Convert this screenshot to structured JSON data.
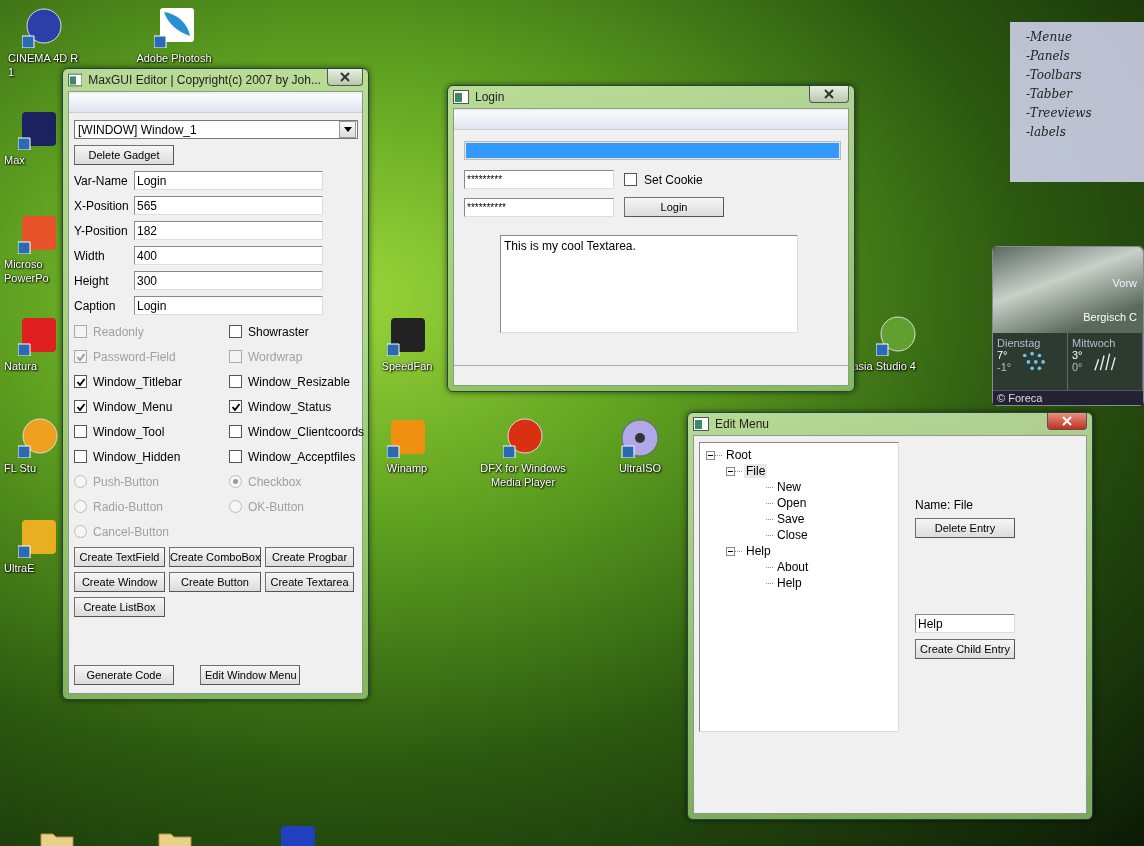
{
  "desktop_icons": [
    {
      "kind": "globe",
      "label": [
        "CINEMA 4D R",
        "1"
      ]
    },
    {
      "kind": "feather",
      "label": [
        "Adobe Photosh"
      ]
    },
    {
      "kind": "blitz",
      "label": [
        "Max"
      ]
    },
    {
      "kind": "slides",
      "label": [
        "Microso",
        "PowerPo"
      ]
    },
    {
      "kind": "paint",
      "label": [
        "Natura"
      ]
    },
    {
      "kind": "fruit",
      "label": [
        "FL Stu"
      ]
    },
    {
      "kind": "editor",
      "label": [
        "UltraE"
      ]
    },
    {
      "kind": "fan",
      "label": [
        "SpeedFan"
      ]
    },
    {
      "kind": "bolt",
      "label": [
        "Winamp"
      ]
    },
    {
      "kind": "dfx",
      "label": [
        "DFX for Windows",
        "Media Player"
      ]
    },
    {
      "kind": "disc",
      "label": [
        "UltraISO"
      ]
    },
    {
      "kind": "camtasia",
      "label": [
        "asia Studio 4"
      ]
    },
    {
      "kind": "folder"
    },
    {
      "kind": "folder"
    },
    {
      "kind": "network"
    }
  ],
  "note": {
    "lines": [
      "-Menue",
      "-Panels",
      "-Toolbars",
      "-Tabber",
      "-Treeviews",
      "-labels"
    ]
  },
  "weather": {
    "condition": "Vorw",
    "city": "Bergisch C",
    "days": [
      {
        "name": "Dienstag",
        "high": "7°",
        "low": "-1°",
        "kind": "rain"
      },
      {
        "name": "Mittwoch",
        "high": "3°",
        "low": "0°",
        "kind": "sleet"
      }
    ],
    "credit": "© Foreca"
  },
  "editor": {
    "title": "MaxGUI Editor | Copyright(c) 2007 by Joh...",
    "combo": "[WINDOW] Window_1",
    "delete_button": "Delete Gadget",
    "fields": [
      {
        "label": "Var-Name",
        "value": "Login"
      },
      {
        "label": "X-Position",
        "value": "565"
      },
      {
        "label": "Y-Position",
        "value": "182"
      },
      {
        "label": "Width",
        "value": "400"
      },
      {
        "label": "Height",
        "value": "300"
      },
      {
        "label": "Caption",
        "value": "Login"
      }
    ],
    "options": [
      {
        "kind": "checkbox",
        "label": "Readonly",
        "checked": false,
        "disabled": true
      },
      {
        "kind": "checkbox",
        "label": "Showraster",
        "checked": false,
        "disabled": false
      },
      {
        "kind": "checkbox",
        "label": "Password-Field",
        "checked": true,
        "disabled": true
      },
      {
        "kind": "checkbox",
        "label": "Wordwrap",
        "checked": false,
        "disabled": true
      },
      {
        "kind": "checkbox",
        "label": "Window_Titlebar",
        "checked": true,
        "disabled": false
      },
      {
        "kind": "checkbox",
        "label": "Window_Resizable",
        "checked": false,
        "disabled": false
      },
      {
        "kind": "checkbox",
        "label": "Window_Menu",
        "checked": true,
        "disabled": false
      },
      {
        "kind": "checkbox",
        "label": "Window_Status",
        "checked": true,
        "disabled": false
      },
      {
        "kind": "checkbox",
        "label": "Window_Tool",
        "checked": false,
        "disabled": false
      },
      {
        "kind": "checkbox",
        "label": "Window_Clientcoords",
        "checked": false,
        "disabled": false
      },
      {
        "kind": "checkbox",
        "label": "Window_Hidden",
        "checked": false,
        "disabled": false
      },
      {
        "kind": "checkbox",
        "label": "Window_Acceptfiles",
        "checked": false,
        "disabled": false
      },
      {
        "kind": "radio",
        "label": "Push-Button",
        "selected": false,
        "disabled": true
      },
      {
        "kind": "radio",
        "label": "Checkbox",
        "selected": true,
        "disabled": true
      },
      {
        "kind": "radio",
        "label": "Radio-Button",
        "selected": false,
        "disabled": true
      },
      {
        "kind": "radio",
        "label": "OK-Button",
        "selected": false,
        "disabled": true
      },
      {
        "kind": "radio",
        "label": "Cancel-Button",
        "selected": false,
        "disabled": true
      }
    ],
    "create_buttons": [
      "Create TextField",
      "Create ComboBox",
      "Create Progbar",
      "Create Window",
      "Create Button",
      "Create Textarea",
      "Create ListBox"
    ],
    "bottom_buttons": [
      "Generate Code",
      "Edit Window Menu"
    ]
  },
  "login": {
    "title": "Login",
    "progress": {
      "level": 1
    },
    "password_1": "*********",
    "password_2": "**********",
    "cookie": {
      "label": "Set Cookie",
      "checked": false
    },
    "login_button": "Login",
    "textarea": "This is my cool Textarea."
  },
  "edit_menu": {
    "title": "Edit Menu",
    "tree": [
      {
        "label": "Root",
        "expanded": true,
        "selected": false,
        "children": [
          {
            "label": "File",
            "expanded": true,
            "selected": true,
            "children": [
              {
                "label": "New",
                "selected": false
              },
              {
                "label": "Open",
                "selected": false
              },
              {
                "label": "Save",
                "selected": false
              },
              {
                "label": "Close",
                "selected": false
              }
            ]
          },
          {
            "label": "Help",
            "expanded": true,
            "selected": false,
            "children": [
              {
                "label": "About",
                "selected": false
              },
              {
                "label": "Help",
                "selected": false
              }
            ]
          }
        ]
      }
    ],
    "name_label": "Name: File",
    "delete_button": "Delete Entry",
    "entry_field": "Help",
    "create_button": "Create Child Entry"
  }
}
